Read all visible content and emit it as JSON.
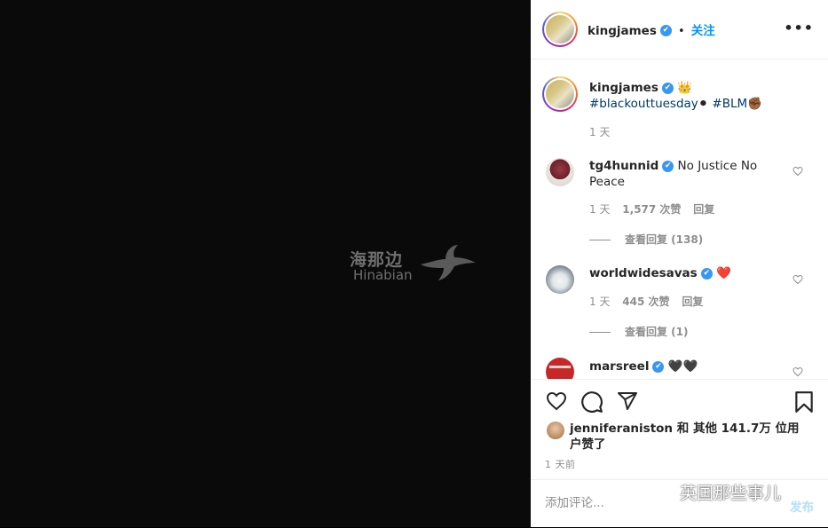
{
  "watermark": {
    "cn": "海那边",
    "en": "Hinabian"
  },
  "header": {
    "username": "kingjames",
    "verified_mark": "✔",
    "follow_label": "关注",
    "more_label": "•••"
  },
  "caption": {
    "username": "kingjames",
    "emoji_crown": "👑",
    "hashtag1": "#blackouttuesday",
    "emoji_circle": "⚫",
    "hashtag2": "#BLM",
    "emoji_fist": "✊🏾",
    "time": "1 天"
  },
  "comments": [
    {
      "username": "tg4hunnid",
      "text": "No Justice No Peace",
      "time": "1 天",
      "likes": "1,577 次赞",
      "reply": "回复",
      "view_replies": "查看回复 (138)"
    },
    {
      "username": "worldwidesavas",
      "text": "❤️",
      "time": "1 天",
      "likes": "445 次赞",
      "reply": "回复",
      "view_replies": "查看回复 (1)"
    },
    {
      "username": "marsreel",
      "text": "🖤🖤"
    }
  ],
  "likes_line": "jenniferaniston 和 其他 141.7万 位用户赞了",
  "post_time": "1 天前",
  "comment_box": {
    "placeholder": "添加评论...",
    "post_label": "发布"
  },
  "wechat_watermark": "英国那些事儿",
  "icons": [
    "heart-icon",
    "comment-icon",
    "share-icon",
    "bookmark-icon",
    "more-icon",
    "verified-icon",
    "small-heart-icon",
    "wechat-icon",
    "bird-logo-icon"
  ],
  "colors": {
    "accent": "#0095f6",
    "verified": "#3897f0",
    "hashtag": "#00376b",
    "muted": "#8e8e8e",
    "post_disabled": "#b2dffc"
  }
}
